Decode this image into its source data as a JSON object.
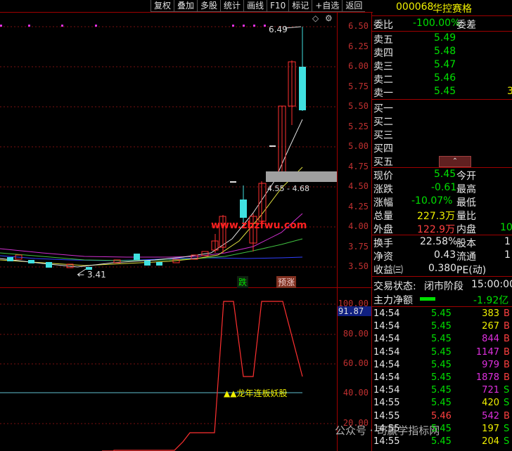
{
  "toolbar": [
    "复权",
    "叠加",
    "多股",
    "统计",
    "画线",
    "F10",
    "标记",
    "+自选",
    "返回"
  ],
  "price_axis": [
    "6.50",
    "6.25",
    "6.00",
    "5.75",
    "5.50",
    "5.25",
    "5.00",
    "4.75",
    "4.50",
    "4.25",
    "4.00",
    "3.75",
    "3.50"
  ],
  "indicator_axis": [
    "100.00",
    "80.00",
    "60.00",
    "40.00",
    "20.00"
  ],
  "indicator_current": "91.87",
  "annotations": {
    "high": "6.49",
    "low": "3.41",
    "range": "4.55 - 4.68",
    "watermark": "www.zbzfwu.com",
    "tag_down": "跌",
    "tag_warn": "预涨",
    "indicator_label": "▲▲龙年连板妖股",
    "wechat": "公众号 · 司赢学指标网"
  },
  "stock": {
    "code": "000068",
    "name": "华控赛格"
  },
  "order_ratio": {
    "label": "委比",
    "value": "-100.00%",
    "label2": "委差"
  },
  "asks": [
    {
      "label": "卖五",
      "price": "5.49",
      "vol": ""
    },
    {
      "label": "卖四",
      "price": "5.48",
      "vol": ""
    },
    {
      "label": "卖三",
      "price": "5.47",
      "vol": ""
    },
    {
      "label": "卖二",
      "price": "5.46",
      "vol": ""
    },
    {
      "label": "卖一",
      "price": "5.45",
      "vol": "3"
    }
  ],
  "bids": [
    {
      "label": "买一"
    },
    {
      "label": "买二"
    },
    {
      "label": "买三"
    },
    {
      "label": "买四"
    },
    {
      "label": "买五"
    }
  ],
  "quote": [
    {
      "l1": "现价",
      "v1": "5.45",
      "l2": "今开",
      "v2": ""
    },
    {
      "l1": "涨跌",
      "v1": "-0.61",
      "l2": "最高",
      "v2": ""
    },
    {
      "l1": "涨幅",
      "v1": "-10.07%",
      "l2": "最低",
      "v2": ""
    },
    {
      "l1": "总量",
      "v1": "227.3万",
      "l2": "量比",
      "v2": ""
    },
    {
      "l1": "外盘",
      "v1": "122.9万",
      "l2": "内盘",
      "v2": "10"
    }
  ],
  "stats": [
    {
      "l1": "换手",
      "v1": "22.58%",
      "l2": "股本",
      "v2": "1"
    },
    {
      "l1": "净资",
      "v1": "0.43",
      "l2": "流通",
      "v2": "1"
    },
    {
      "l1": "收益㈢",
      "v1": "0.380",
      "l2": "PE(动)",
      "v2": ""
    }
  ],
  "status": {
    "label": "交易状态:",
    "value": "闭市阶段",
    "time": "15:00:00"
  },
  "main_flow": {
    "label": "主力净额",
    "value": "-1.92亿"
  },
  "trades": [
    {
      "t": "14:54",
      "p": "5.45",
      "v": "383",
      "s": "B",
      "vc": "yellow"
    },
    {
      "t": "14:54",
      "p": "5.45",
      "v": "267",
      "s": "B",
      "vc": "yellow"
    },
    {
      "t": "14:54",
      "p": "5.45",
      "v": "844",
      "s": "B",
      "vc": "magenta"
    },
    {
      "t": "14:54",
      "p": "5.45",
      "v": "1147",
      "s": "B",
      "vc": "magenta"
    },
    {
      "t": "14:54",
      "p": "5.45",
      "v": "979",
      "s": "B",
      "vc": "magenta"
    },
    {
      "t": "14:54",
      "p": "5.45",
      "v": "1878",
      "s": "B",
      "vc": "magenta"
    },
    {
      "t": "14:54",
      "p": "5.45",
      "v": "721",
      "s": "S",
      "vc": "magenta"
    },
    {
      "t": "14:55",
      "p": "5.45",
      "v": "420",
      "s": "S",
      "vc": "yellow"
    },
    {
      "t": "14:55",
      "p": "5.46",
      "v": "542",
      "s": "B",
      "vc": "magenta"
    },
    {
      "t": "14:55",
      "p": "5.45",
      "v": "197",
      "s": "S",
      "vc": "yellow"
    },
    {
      "t": "14:55",
      "p": "5.45",
      "v": "204",
      "s": "S",
      "vc": "yellow"
    }
  ],
  "colors": {
    "up": "#ff3030",
    "down": "#40e0e0",
    "axis": "#c03030",
    "bg": "#000000"
  }
}
